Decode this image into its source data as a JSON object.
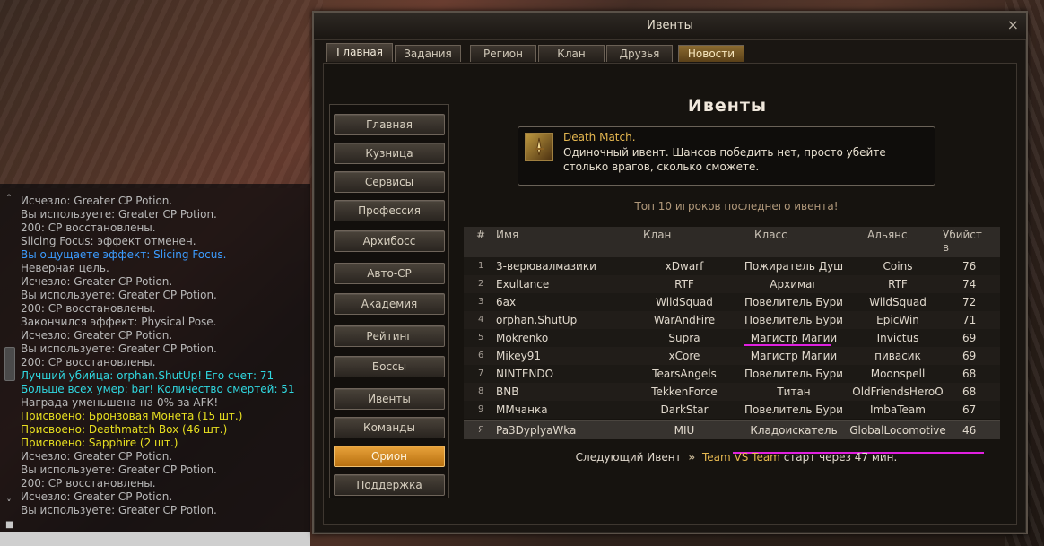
{
  "window": {
    "title": "Ивенты",
    "close_label": "×",
    "tabs": [
      {
        "label": "Главная"
      },
      {
        "label": "Задания"
      },
      {
        "label": "Регион"
      },
      {
        "label": "Клан"
      },
      {
        "label": "Друзья"
      },
      {
        "label": "Новости"
      }
    ]
  },
  "menu": [
    {
      "label": "Главная"
    },
    {
      "label": "Кузница"
    },
    {
      "label": "Сервисы"
    },
    {
      "label": "Профессия"
    },
    {
      "label": "Архибосс"
    },
    {
      "label": "Авто-CP"
    },
    {
      "label": "Академия"
    },
    {
      "label": "Рейтинг"
    },
    {
      "label": "Боссы"
    },
    {
      "label": "Ивенты"
    },
    {
      "label": "Команды"
    },
    {
      "label": "Орион"
    },
    {
      "label": "Поддержка"
    }
  ],
  "heading": "Ивенты",
  "event": {
    "title": "Death Match.",
    "description": "Одиночный ивент. Шансов победить нет, просто убейте столько врагов, сколько сможете.",
    "icon": "sword-event-icon"
  },
  "top10_label": "Топ 10 игроков последнего ивента!",
  "table": {
    "headers": {
      "num": "#",
      "name": "Имя",
      "clan": "Клан",
      "class": "Класс",
      "alliance": "Альянс",
      "kills": "Убийств"
    },
    "rows": [
      {
        "num": "1",
        "name": "3-верювалмазики",
        "clan": "xDwarf",
        "class": "Пожиратель Душ",
        "alliance": "Coins",
        "kills": "76"
      },
      {
        "num": "2",
        "name": "Exultance",
        "clan": "RTF",
        "class": "Архимаг",
        "alliance": "RTF",
        "kills": "74"
      },
      {
        "num": "3",
        "name": "6ax",
        "clan": "WildSquad",
        "class": "Повелитель Бури",
        "alliance": "WildSquad",
        "kills": "72"
      },
      {
        "num": "4",
        "name": "orphan.ShutUp",
        "clan": "WarAndFire",
        "class": "Повелитель Бури",
        "alliance": "EpicWin",
        "kills": "71"
      },
      {
        "num": "5",
        "name": "Mokrenko",
        "clan": "Supra",
        "class": "Магистр Магии",
        "alliance": "Invictus",
        "kills": "69"
      },
      {
        "num": "6",
        "name": "Mikey91",
        "clan": "xCore",
        "class": "Магистр Магии",
        "alliance": "пивасик",
        "kills": "69"
      },
      {
        "num": "7",
        "name": "NINTENDO",
        "clan": "TearsAngels",
        "class": "Повелитель Бури",
        "alliance": "Moonspell",
        "kills": "68"
      },
      {
        "num": "8",
        "name": "BNB",
        "clan": "TekkenForce",
        "class": "Титан",
        "alliance": "OldFriendsHeroO",
        "kills": "68"
      },
      {
        "num": "9",
        "name": "MMчанка",
        "clan": "DarkStar",
        "class": "Повелитель Бури",
        "alliance": "ImbaTeam",
        "kills": "67"
      }
    ],
    "me": {
      "num": "Я",
      "name": "Pa3DyplyaWka",
      "clan": "MIU",
      "class": "Кладоискатель",
      "alliance": "GlobalLocomotive",
      "kills": "46"
    }
  },
  "next_event": {
    "prefix": "Следующий Ивент",
    "arrow": "»",
    "name": "Team VS Team",
    "suffix": "старт через 47 мин."
  },
  "chat": {
    "lines": [
      {
        "text": "Исчезло: Greater CP Potion.",
        "color": "gray"
      },
      {
        "text": "Вы используете: Greater CP Potion.",
        "color": "gray"
      },
      {
        "text": "200: CP восстановлены.",
        "color": "gray"
      },
      {
        "text": "Slicing Focus: эффект отменен.",
        "color": "gray"
      },
      {
        "text": "Вы ощущаете эффект: Slicing Focus.",
        "color": "blue"
      },
      {
        "text": "Неверная цель.",
        "color": "gray"
      },
      {
        "text": "Исчезло: Greater CP Potion.",
        "color": "gray"
      },
      {
        "text": "Вы используете: Greater CP Potion.",
        "color": "gray"
      },
      {
        "text": "200: CP восстановлены.",
        "color": "gray"
      },
      {
        "text": "Закончился эффект: Physical Pose.",
        "color": "gray"
      },
      {
        "text": "Исчезло: Greater CP Potion.",
        "color": "gray"
      },
      {
        "text": "Вы используете: Greater CP Potion.",
        "color": "gray"
      },
      {
        "text": "200: CP восстановлены.",
        "color": "gray"
      },
      {
        "text": "Лучший убийца: orphan.ShutUp! Его счет: 71",
        "color": "cyan"
      },
      {
        "text": "Больше всех умер: bar! Количество смертей: 51",
        "color": "cyan"
      },
      {
        "text": "Награда уменьшена на 0% за AFK!",
        "color": "gray"
      },
      {
        "text": "Присвоено: Бронзовая Монета (15 шт.)",
        "color": "yellow"
      },
      {
        "text": "Присвоено: Deathmatch Box (46 шт.)",
        "color": "yellow"
      },
      {
        "text": "Присвоено: Sapphire (2 шт.)",
        "color": "yellow"
      },
      {
        "text": "Исчезло: Greater CP Potion.",
        "color": "gray"
      },
      {
        "text": "Вы используете: Greater CP Potion.",
        "color": "gray"
      },
      {
        "text": "200: CP восстановлены.",
        "color": "gray"
      },
      {
        "text": "Исчезло: Greater CP Potion.",
        "color": "gray"
      },
      {
        "text": "Вы используете: Greater CP Potion.",
        "color": "gray"
      }
    ],
    "scroll_up": "˄",
    "scroll_down": "˅"
  },
  "colors": {
    "accent": "#e6b850",
    "highlight_underline": "#e020e0",
    "active_menu": "#d08a20"
  }
}
